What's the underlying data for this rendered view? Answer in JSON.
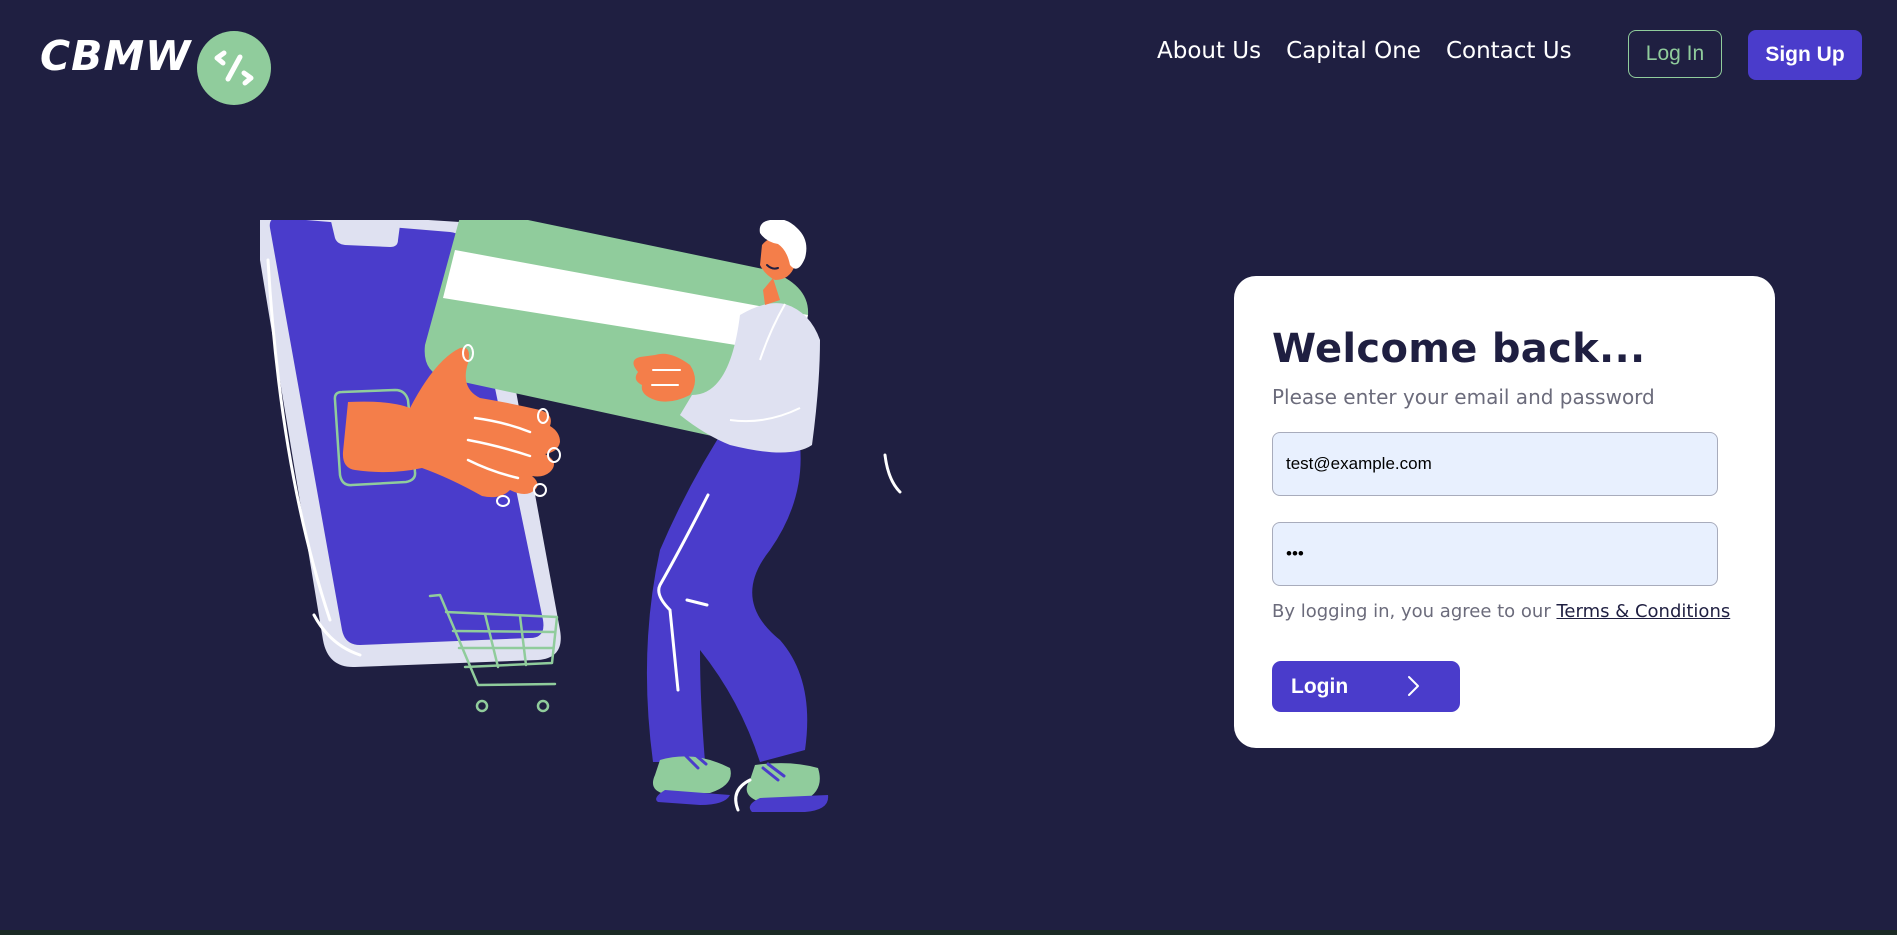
{
  "brand": {
    "name": "CBMW",
    "badge_icon": "percent-icon",
    "badge_color": "#90cc9c"
  },
  "nav": {
    "links": [
      "About Us",
      "Capital One",
      "Contact Us"
    ],
    "login_label": "Log In",
    "signup_label": "Sign Up"
  },
  "login_form": {
    "title": "Welcome back...",
    "subtitle": "Please enter your email and password",
    "email_value": "test@example.com",
    "password_value": "•••",
    "terms_prefix": "By logging in, you agree to our ",
    "terms_link": "Terms & Conditions",
    "submit_label": "Login",
    "submit_icon": "chevron-right-icon"
  },
  "colors": {
    "background": "#1f1f41",
    "accent": "#4a3ccb",
    "green": "#90cc9c",
    "orange": "#f47e4a",
    "card": "#ffffff"
  }
}
